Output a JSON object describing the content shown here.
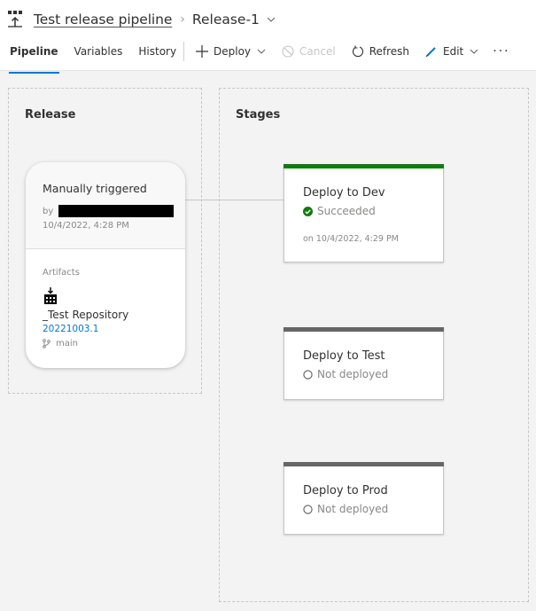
{
  "header": {
    "pipeline_name": "Test release pipeline",
    "release_name": "Release-1",
    "pipeline_icon": "release-pipeline-icon"
  },
  "tabs": [
    {
      "label": "Pipeline",
      "active": true
    },
    {
      "label": "Variables",
      "active": false
    },
    {
      "label": "History",
      "active": false
    }
  ],
  "toolbar": {
    "deploy_label": "Deploy",
    "cancel_label": "Cancel",
    "refresh_label": "Refresh",
    "edit_label": "Edit",
    "more_label": "···"
  },
  "release_panel": {
    "title": "Release",
    "trigger_label": "Manually triggered",
    "by_label": "by",
    "triggered_at": "10/4/2022, 4:28 PM",
    "artifacts_label": "Artifacts",
    "artifact": {
      "name": "_Test Repository",
      "build": "20221003.1",
      "branch": "main"
    }
  },
  "stages_panel": {
    "title": "Stages",
    "stages": [
      {
        "name": "Deploy to Dev",
        "status": "Succeeded",
        "time": "on 10/4/2022, 4:29 PM",
        "color": "#107c10"
      },
      {
        "name": "Deploy to Test",
        "status": "Not deployed",
        "color": "#666666"
      },
      {
        "name": "Deploy to Prod",
        "status": "Not deployed",
        "color": "#666666"
      }
    ]
  }
}
